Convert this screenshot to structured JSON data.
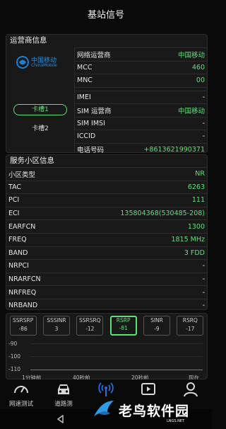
{
  "header": {
    "title": "基站信号"
  },
  "operator": {
    "section_title": "运营商信息",
    "logo_cn": "中国移动",
    "logo_en": "ChinaMobile",
    "slot1_label": "卡槽1",
    "slot2_label": "卡槽2",
    "rows": [
      {
        "label": "网络运营商",
        "value": "中国移动",
        "green": true
      },
      {
        "label": "MCC",
        "value": "460",
        "green": true
      },
      {
        "label": "MNC",
        "value": "00",
        "green": true
      },
      {
        "label": "IMEI",
        "value": "-",
        "green": false
      },
      {
        "label": "SIM 运营商",
        "value": "中国移动",
        "green": true
      },
      {
        "label": "SIM IMSI",
        "value": "-",
        "green": false
      },
      {
        "label": "ICCID",
        "value": "-",
        "green": false
      },
      {
        "label": "电话号码",
        "value": "+8613621990371",
        "green": true
      }
    ]
  },
  "serving_cell": {
    "section_title": "服务小区信息",
    "rows": [
      {
        "label": "小区类型",
        "value": "NR",
        "green": true
      },
      {
        "label": "TAC",
        "value": "6263",
        "green": true
      },
      {
        "label": "PCI",
        "value": "111",
        "green": true
      },
      {
        "label": "ECI",
        "value": "135804368(530485-208)",
        "green": true
      },
      {
        "label": "EARFCN",
        "value": "1300",
        "green": true
      },
      {
        "label": "FREQ",
        "value": "1815 MHz",
        "green": true
      },
      {
        "label": "BAND",
        "value": "3 FDD",
        "green": true
      },
      {
        "label": "NRPCI",
        "value": "-",
        "green": false
      },
      {
        "label": "NRARFCN",
        "value": "-",
        "green": false
      },
      {
        "label": "NRFREQ",
        "value": "-",
        "green": false
      },
      {
        "label": "NRBAND",
        "value": "-",
        "green": false
      }
    ]
  },
  "signal": {
    "chips": [
      {
        "name": "SSRSRP",
        "value": "-86",
        "active": false
      },
      {
        "name": "SSSINR",
        "value": "3",
        "active": false
      },
      {
        "name": "SSRSRQ",
        "value": "-12",
        "active": false
      },
      {
        "name": "RSRP",
        "value": "-81",
        "active": true
      },
      {
        "name": "SINR",
        "value": "-9",
        "active": false
      },
      {
        "name": "RSRQ",
        "value": "-17",
        "active": false
      }
    ],
    "y_ticks": [
      "-90",
      "-100",
      "-110"
    ],
    "x_ticks": [
      "1分钟前",
      "40秒前",
      "20秒前",
      "现在"
    ]
  },
  "nav": {
    "items": [
      {
        "label": "网速测试",
        "icon": "speedometer-icon"
      },
      {
        "label": "道路测",
        "icon": "car-icon"
      },
      {
        "label": "",
        "icon": "signal-tower-icon"
      },
      {
        "label": "",
        "icon": "video-icon"
      },
      {
        "label": "",
        "icon": "person-icon"
      }
    ]
  },
  "watermark": {
    "text": "老鸟软件园",
    "url": "LNGS.NET"
  },
  "colors": {
    "accent": "#5fe07a",
    "background": "#0a0a0a",
    "card": "#191919"
  }
}
